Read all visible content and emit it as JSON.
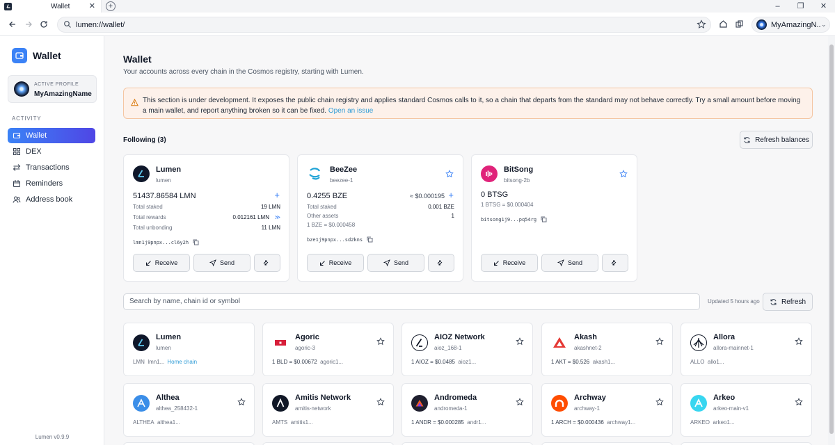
{
  "browser": {
    "tab_title": "Wallet",
    "url": "lumen://wallet/",
    "profile_name": "MyAmazingN..."
  },
  "sidebar": {
    "brand": "Wallet",
    "profile_label": "ACTIVE PROFILE",
    "profile_name": "MyAmazingName",
    "section_label": "ACTIVITY",
    "items": [
      {
        "label": "Wallet",
        "icon": "wallet-icon",
        "active": true
      },
      {
        "label": "DEX",
        "icon": "grid-icon",
        "active": false
      },
      {
        "label": "Transactions",
        "icon": "arrows-icon",
        "active": false
      },
      {
        "label": "Reminders",
        "icon": "calendar-icon",
        "active": false
      },
      {
        "label": "Address book",
        "icon": "users-icon",
        "active": false
      }
    ],
    "version": "Lumen v0.9.9"
  },
  "main": {
    "title": "Wallet",
    "subtitle": "Your accounts across every chain in the Cosmos registry, starting with Lumen.",
    "warning_text": "This section is under development. It exposes the public chain registry and applies standard Cosmos calls to it, so a chain that departs from the standard may not behave correctly. Try a small amount before moving a main wallet, and report anything broken so it can be fixed.",
    "warning_link": "Open an issue",
    "following_title": "Following (3)",
    "refresh_balances": "Refresh balances",
    "search_placeholder": "Search by name, chain id or symbol",
    "updated": "Updated 5 hours ago",
    "refresh": "Refresh"
  },
  "following": [
    {
      "name": "Lumen",
      "chain": "lumen",
      "balance": "51437.86584 LMN",
      "usd": "",
      "rows": [
        {
          "label": "Total staked",
          "value": "19 LMN"
        },
        {
          "label": "Total rewards",
          "value": "0.012161 LMN"
        },
        {
          "label": "Total unbonding",
          "value": "11 LMN"
        }
      ],
      "rate": "",
      "address": "lmn1j9pnpx...cl6y2h"
    },
    {
      "name": "BeeZee",
      "chain": "beezee-1",
      "balance": "0.4255 BZE",
      "usd": "≈ $0.000195",
      "rows": [
        {
          "label": "Total staked",
          "value": "0.001 BZE"
        },
        {
          "label": "Other assets",
          "value": "1"
        }
      ],
      "rate": "1 BZE = $0.000458",
      "address": "bze1j9pnpx...sd2kns"
    },
    {
      "name": "BitSong",
      "chain": "bitsong-2b",
      "balance": "0 BTSG",
      "usd": "",
      "rows": [],
      "rate": "1 BTSG = $0.000404",
      "address": "bitsong1j9...pq54rg"
    }
  ],
  "actions": {
    "receive": "Receive",
    "send": "Send"
  },
  "chains": [
    {
      "name": "Lumen",
      "chain": "lumen",
      "symbol": "LMN",
      "addr": "lmn1...",
      "rate": "",
      "home": "Home chain"
    },
    {
      "name": "Agoric",
      "chain": "agoric-3",
      "symbol": "",
      "addr": "agoric1...",
      "rate": "1 BLD = $0.00672",
      "home": ""
    },
    {
      "name": "AIOZ Network",
      "chain": "aioz_168-1",
      "symbol": "",
      "addr": "aioz1...",
      "rate": "1 AIOZ = $0.0485",
      "home": ""
    },
    {
      "name": "Akash",
      "chain": "akashnet-2",
      "symbol": "",
      "addr": "akash1...",
      "rate": "1 AKT = $0.526",
      "home": ""
    },
    {
      "name": "Allora",
      "chain": "allora-mainnet-1",
      "symbol": "ALLO",
      "addr": "allo1...",
      "rate": "",
      "home": ""
    },
    {
      "name": "Althea",
      "chain": "althea_258432-1",
      "symbol": "ALTHEA",
      "addr": "althea1...",
      "rate": "",
      "home": ""
    },
    {
      "name": "Amitis Network",
      "chain": "amitis-network",
      "symbol": "AMTS",
      "addr": "amitis1...",
      "rate": "",
      "home": ""
    },
    {
      "name": "Andromeda",
      "chain": "andromeda-1",
      "symbol": "",
      "addr": "andr1...",
      "rate": "1 ANDR = $0.000285",
      "home": ""
    },
    {
      "name": "Archway",
      "chain": "archway-1",
      "symbol": "",
      "addr": "archway1...",
      "rate": "1 ARCH = $0.000436",
      "home": ""
    },
    {
      "name": "Arkeo",
      "chain": "arkeo-main-v1",
      "symbol": "ARKEO",
      "addr": "arkeo1...",
      "rate": "",
      "home": ""
    }
  ],
  "colors": {
    "accent": "#3b82f6",
    "accent2": "#4f46e5",
    "link": "#2e9bd6",
    "warning_bg": "#fdf1ea"
  }
}
